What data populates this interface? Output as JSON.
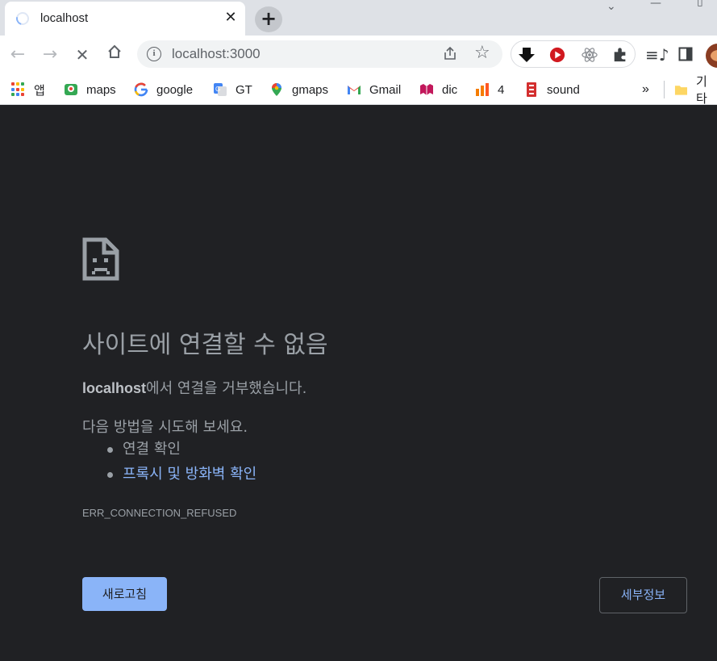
{
  "tab": {
    "title": "localhost"
  },
  "toolbar": {
    "url": "localhost:3000",
    "info_symbol": "i"
  },
  "bookmarks": [
    {
      "label": "앱",
      "icon": "apps-grid-icon"
    },
    {
      "label": "maps",
      "icon": "maps-icon"
    },
    {
      "label": "google",
      "icon": "google-icon"
    },
    {
      "label": "GT",
      "icon": "google-translate-icon"
    },
    {
      "label": "gmaps",
      "icon": "gmaps-pin-icon"
    },
    {
      "label": "Gmail",
      "icon": "gmail-icon"
    },
    {
      "label": "dic",
      "icon": "dictionary-icon"
    },
    {
      "label": "4",
      "icon": "bars-icon"
    },
    {
      "label": "sound",
      "icon": "sound-icon"
    }
  ],
  "bookmarks_overflow": "»",
  "other_bookmarks": "기타",
  "error": {
    "title": "사이트에 연결할 수 없음",
    "host": "localhost",
    "desc_suffix": "에서 연결을 거부했습니다.",
    "suggest": "다음 방법을 시도해 보세요.",
    "suggestions": [
      {
        "label": "연결 확인",
        "link": false
      },
      {
        "label": "프록시 및 방화벽 확인",
        "link": true
      }
    ],
    "code": "ERR_CONNECTION_REFUSED",
    "reload_button": "새로고침",
    "details_button": "세부정보"
  },
  "colors": {
    "page_background": "#202124",
    "text_secondary": "#9aa0a6",
    "link": "#8ab4f8",
    "primary_button": "#8ab4f8"
  }
}
